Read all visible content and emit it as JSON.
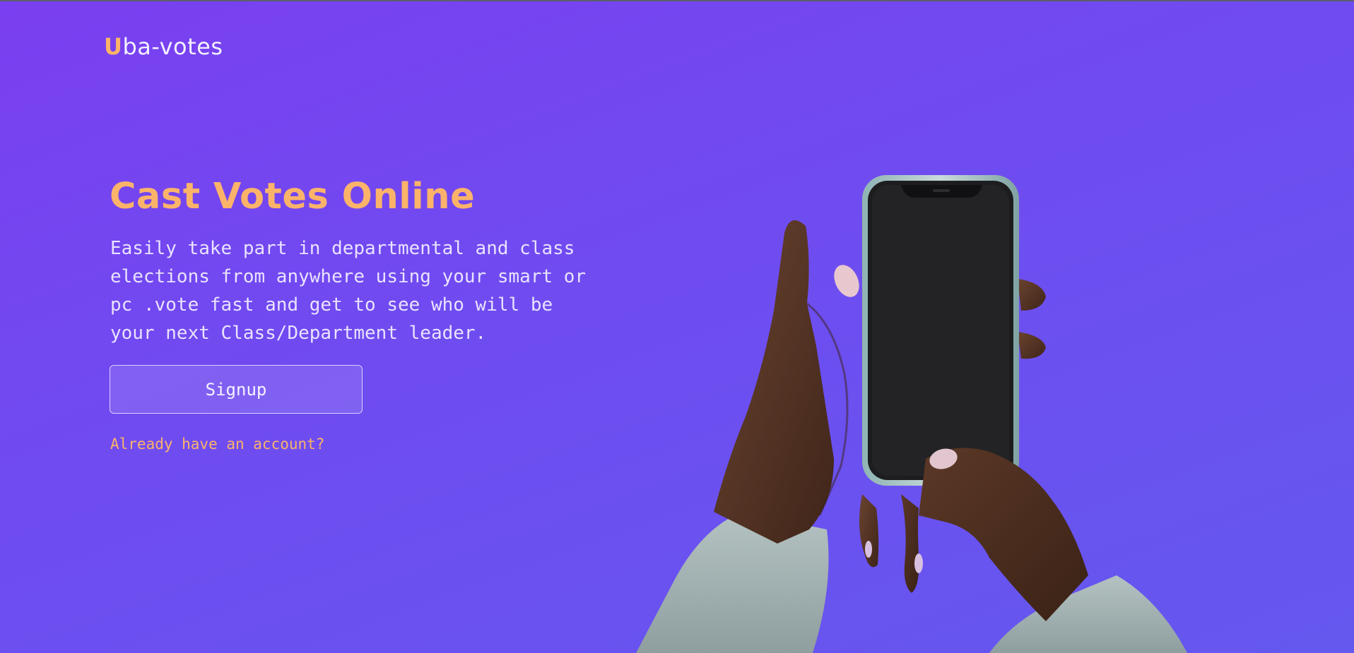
{
  "brand": {
    "logo_first": "U",
    "logo_rest": "ba-votes"
  },
  "hero": {
    "title": "Cast Votes Online",
    "description": "Easily take part in departmental and class\nelections from anywhere using your smart or\npc .vote fast and get to see who will be\nyour next Class/Department leader.",
    "signup_label": "Signup",
    "login_link": "Already have an account?"
  },
  "colors": {
    "background_start": "#7a3ff0",
    "background_end": "#6458ef",
    "accent": "#fbb36a",
    "text": "#e9e3ff"
  },
  "icons": {
    "hero_image": "hands-holding-phone-illustration"
  }
}
